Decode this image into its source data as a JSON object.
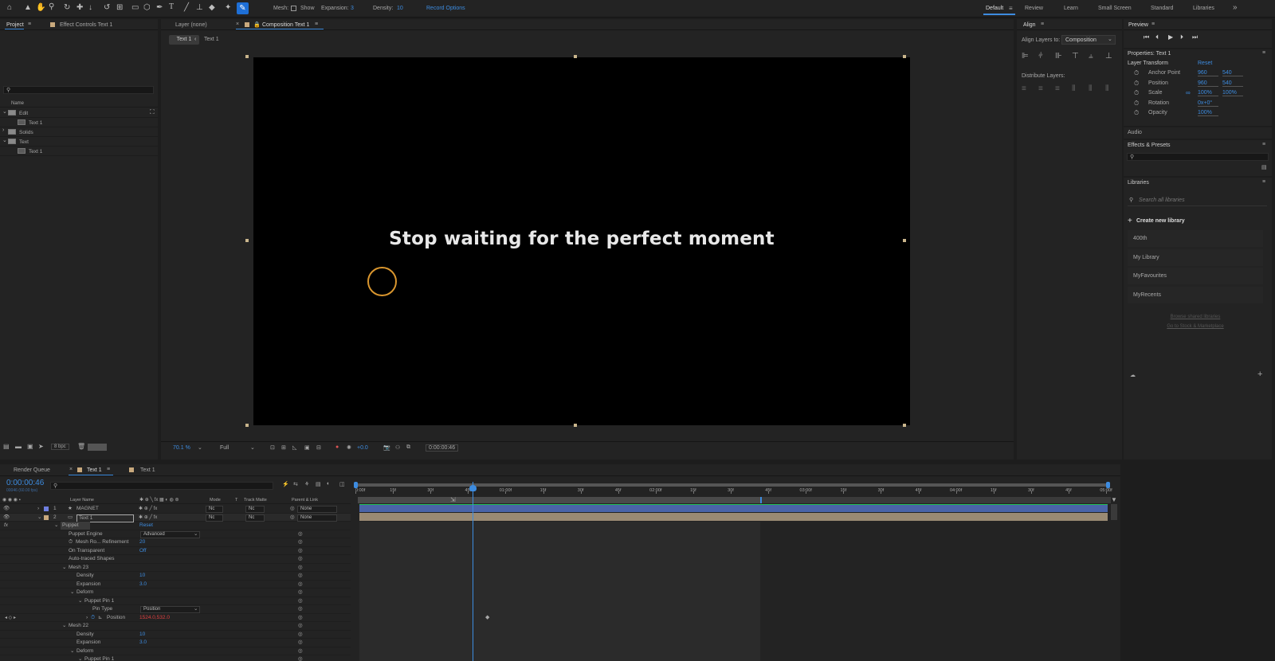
{
  "toolbar": {
    "mesh_label": "Mesh:",
    "show_label": "Show",
    "expansion_label": "Expansion:",
    "expansion_value": "3",
    "density_label": "Density:",
    "density_value": "10",
    "record_options": "Record Options",
    "workspaces": [
      "Default",
      "Review",
      "Learn",
      "Small Screen",
      "Standard",
      "Libraries"
    ],
    "more": "»"
  },
  "project": {
    "tab_project": "Project",
    "tab_effect_controls": "Effect Controls Text 1",
    "column_name": "Name",
    "items": [
      {
        "label": "Edit",
        "kind": "folder",
        "indent": 0
      },
      {
        "label": "Text 1",
        "kind": "comp",
        "indent": 1
      },
      {
        "label": "Solids",
        "kind": "folder",
        "indent": 0
      },
      {
        "label": "Text",
        "kind": "folder",
        "indent": 0
      },
      {
        "label": "Text 1",
        "kind": "comp",
        "indent": 1
      }
    ],
    "bpc": "8 bpc"
  },
  "viewer": {
    "layer_tab": "Layer (none)",
    "comp_tab": "Composition Text 1",
    "breadcrumb_1": "Text 1",
    "breadcrumb_2": "Text 1",
    "headline": "Stop waiting for the perfect moment",
    "zoom": "70.1 %",
    "resolution": "Full",
    "exposure": "+0.0",
    "timecode": "0:00:00:46"
  },
  "align": {
    "title": "Align",
    "align_to_label": "Align Layers to:",
    "align_to_value": "Composition",
    "distribute_label": "Distribute Layers:"
  },
  "preview": {
    "title": "Preview"
  },
  "properties": {
    "title": "Properties: Text 1",
    "section": "Layer Transform",
    "reset": "Reset",
    "rows": [
      {
        "label": "Anchor Point",
        "v1": "960",
        "v2": "540"
      },
      {
        "label": "Position",
        "v1": "960",
        "v2": "540"
      },
      {
        "label": "Scale",
        "v1": "100%",
        "v2": "100%"
      },
      {
        "label": "Rotation",
        "v1": "0x+0°",
        "v2": ""
      },
      {
        "label": "Opacity",
        "v1": "100%",
        "v2": ""
      }
    ]
  },
  "audio": {
    "title": "Audio"
  },
  "effects": {
    "title": "Effects & Presets"
  },
  "libraries": {
    "title": "Libraries",
    "search_placeholder": "Search all libraries",
    "create": "Create new library",
    "items": [
      "400th",
      "My Library",
      "MyFavourites",
      "MyRecents"
    ],
    "link_1": "Browse shared libraries",
    "link_2": "Go to Stock & Marketplace"
  },
  "timeline": {
    "tab_render": "Render Queue",
    "tab_comp_1": "Text 1",
    "tab_comp_2": "Text 1",
    "timecode": "0:00:00:46",
    "fps": "00046 (60.00 fps)",
    "col_layer_name": "Layer Name",
    "col_mode": "Mode",
    "col_t": "T",
    "col_track_matte": "Track Matte",
    "col_parent": "Parent & Link",
    "layers": [
      {
        "num": "1",
        "name": "MAGNET",
        "mode": "Nc",
        "matte": "Nc",
        "parent": "None",
        "color": "#6f7fe0"
      },
      {
        "num": "2",
        "name": "Text 1",
        "mode": "Nc",
        "matte": "Nc",
        "parent": "None",
        "color": "#c9a97d"
      }
    ],
    "props": [
      {
        "label": "Puppet",
        "value": "Reset",
        "indent": 1,
        "arrow": "v",
        "value_kind": "link"
      },
      {
        "label": "Puppet Engine",
        "value": "Advanced",
        "indent": 2,
        "arrow": "",
        "value_kind": "dropdown"
      },
      {
        "label": "Mesh Ro... Refinement",
        "value": "20",
        "indent": 2,
        "arrow": "",
        "value_kind": "num",
        "stopwatch": true
      },
      {
        "label": "On Transparent",
        "value": "Off",
        "indent": 2,
        "arrow": "",
        "value_kind": "num"
      },
      {
        "label": "Auto-traced Shapes",
        "value": "",
        "indent": 2,
        "arrow": "",
        "value_kind": "none"
      },
      {
        "label": "Mesh 23",
        "value": "",
        "indent": 2,
        "arrow": "v",
        "value_kind": "none"
      },
      {
        "label": "Density",
        "value": "10",
        "indent": 3,
        "arrow": "",
        "value_kind": "num"
      },
      {
        "label": "Expansion",
        "value": "3.0",
        "indent": 3,
        "arrow": "",
        "value_kind": "num"
      },
      {
        "label": "Deform",
        "value": "",
        "indent": 3,
        "arrow": "v",
        "value_kind": "none"
      },
      {
        "label": "Puppet Pin 1",
        "value": "",
        "indent": 4,
        "arrow": "v",
        "value_kind": "none"
      },
      {
        "label": "Pin Type",
        "value": "Position",
        "indent": 5,
        "arrow": "",
        "value_kind": "dropdown"
      },
      {
        "label": "Position",
        "value": "1524.0,532.0",
        "indent": 5,
        "arrow": ">",
        "value_kind": "red"
      },
      {
        "label": "Mesh 22",
        "value": "",
        "indent": 2,
        "arrow": "v",
        "value_kind": "none"
      },
      {
        "label": "Density",
        "value": "10",
        "indent": 3,
        "arrow": "",
        "value_kind": "num"
      },
      {
        "label": "Expansion",
        "value": "3.0",
        "indent": 3,
        "arrow": "",
        "value_kind": "num"
      },
      {
        "label": "Deform",
        "value": "",
        "indent": 3,
        "arrow": "v",
        "value_kind": "none"
      },
      {
        "label": "Puppet Pin 1",
        "value": "",
        "indent": 4,
        "arrow": "v",
        "value_kind": "none"
      }
    ],
    "ruler": [
      "0:00f",
      "15f",
      "30f",
      "45f",
      "01:00f",
      "15f",
      "30f",
      "45f",
      "02:00f",
      "15f",
      "30f",
      "45f",
      "03:00f",
      "15f",
      "30f",
      "45f",
      "04:00f",
      "15f",
      "30f",
      "45f",
      "05:00f"
    ]
  },
  "colors": {
    "accent": "#3d8ce0",
    "text_layer": "#c9a97d",
    "magnet_layer": "#6f7fe0",
    "pin_circle": "#d9962e"
  }
}
